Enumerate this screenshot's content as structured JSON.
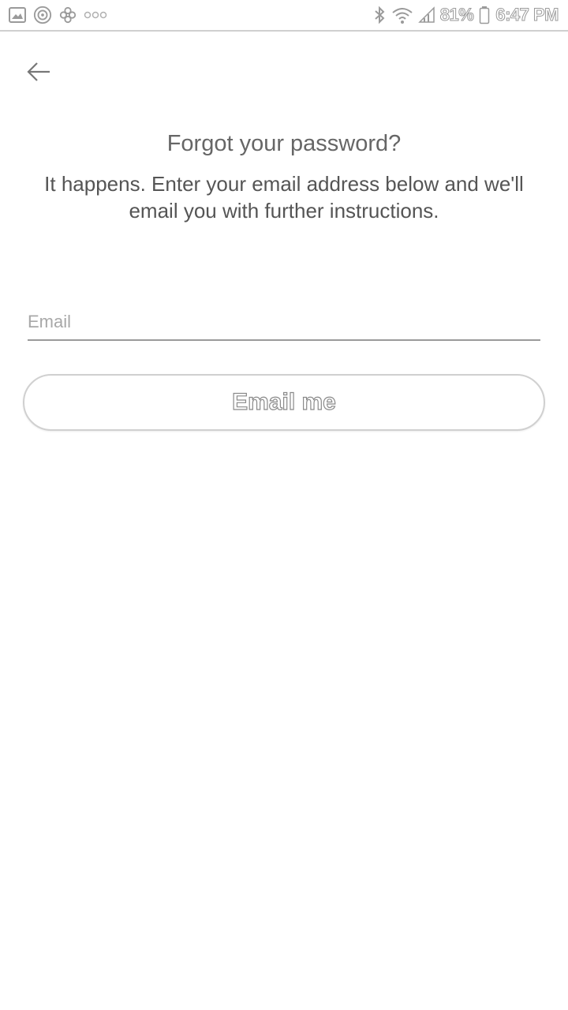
{
  "status_bar": {
    "battery": "81%",
    "time": "6:47 PM",
    "icons": [
      "image-icon",
      "target-icon",
      "pinwheel-icon",
      "more-dots-icon",
      "bluetooth-icon",
      "wifi-icon",
      "signal-icon",
      "battery-icon"
    ]
  },
  "header": {
    "back_icon": "arrow-left-icon"
  },
  "main": {
    "title": "Forgot your password?",
    "subtitle": "It happens. Enter your email address below and we'll email you with further instructions.",
    "email_placeholder": "Email",
    "email_value": "",
    "submit_label": "Email me"
  },
  "colors": {
    "text": "#555555",
    "divider": "#9a9a9a",
    "button_border": "#d0d0d0"
  }
}
